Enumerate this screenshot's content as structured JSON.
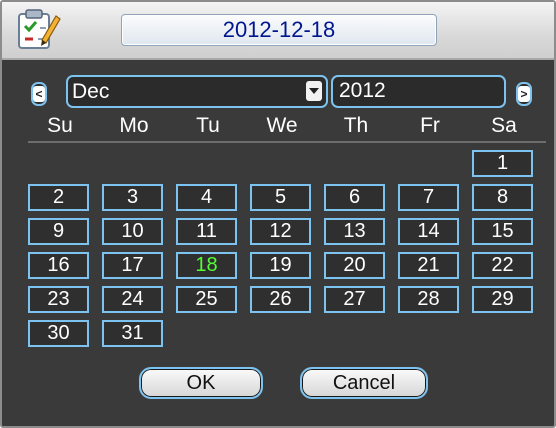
{
  "title": {
    "date": "2012-12-18"
  },
  "nav": {
    "prev_glyph": "<",
    "next_glyph": ">",
    "month": "Dec",
    "year": "2012"
  },
  "weekdays": [
    "Su",
    "Mo",
    "Tu",
    "We",
    "Th",
    "Fr",
    "Sa"
  ],
  "days": [
    [
      "",
      "",
      "",
      "",
      "",
      "",
      "1"
    ],
    [
      "2",
      "3",
      "4",
      "5",
      "6",
      "7",
      "8"
    ],
    [
      "9",
      "10",
      "11",
      "12",
      "13",
      "14",
      "15"
    ],
    [
      "16",
      "17",
      "18",
      "19",
      "20",
      "21",
      "22"
    ],
    [
      "23",
      "24",
      "25",
      "26",
      "27",
      "28",
      "29"
    ],
    [
      "30",
      "31",
      "",
      "",
      "",
      "",
      ""
    ]
  ],
  "selected_day": "18",
  "buttons": {
    "ok": "OK",
    "cancel": "Cancel"
  },
  "colors": {
    "accent_border": "#7dc3ef",
    "selected_text": "#52ff33",
    "title_text": "#00168f",
    "background": "#3a3a3a"
  },
  "icons": {
    "app": "calendar-checklist-icon"
  }
}
